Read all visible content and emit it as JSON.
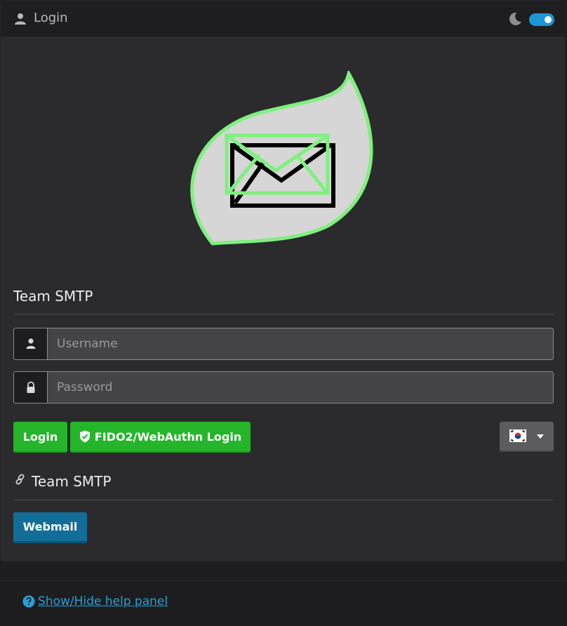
{
  "header": {
    "title": "Login",
    "user_icon": "user-icon",
    "theme_icon": "moon-icon",
    "dark_mode_on": true
  },
  "logo": {
    "icon": "leaf-mail-logo"
  },
  "login_section": {
    "title": "Team SMTP"
  },
  "username": {
    "placeholder": "Username",
    "value": ""
  },
  "password": {
    "placeholder": "Password",
    "value": ""
  },
  "buttons": {
    "login": "Login",
    "fido": "FIDO2/WebAuthn Login"
  },
  "language": {
    "selected": "Korean",
    "icon": "flag-kr-icon"
  },
  "apps_section": {
    "title": "Team SMTP",
    "icon": "link-icon"
  },
  "apps": {
    "webmail": "Webmail"
  },
  "footer": {
    "help_link": "Show/Hide help panel",
    "icon": "question-circle-icon"
  },
  "colors": {
    "accent_green": "#25b52b",
    "accent_blue": "#136d99",
    "link": "#2a9fd6",
    "toggle": "#1e95d4"
  }
}
